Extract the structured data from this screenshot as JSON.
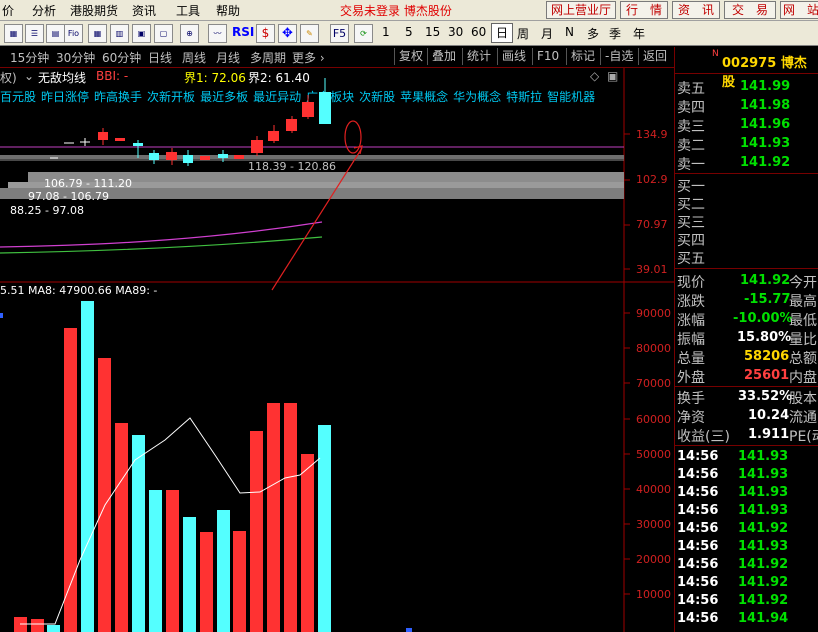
{
  "menubar": {
    "items": [
      "价",
      "分析",
      "港股期货",
      "资讯",
      "工具",
      "帮助"
    ],
    "warning": "交易未登录  博杰股份",
    "right_buttons": [
      "网上营业厅",
      "行　情",
      "资　讯",
      "交　易",
      "网　站"
    ]
  },
  "toolbar": {
    "rsi": "RSI",
    "f5": "F5",
    "periods": [
      "1",
      "5",
      "15",
      "30",
      "60"
    ],
    "views": [
      "日",
      "周",
      "月",
      "N",
      "多",
      "季",
      "年"
    ]
  },
  "periodbar": {
    "periods": [
      "15分钟",
      "30分钟",
      "60分钟",
      "日线",
      "周线",
      "月线",
      "多周期",
      "更多 ›"
    ],
    "buttons": [
      "复权",
      "叠加",
      "统计",
      "画线",
      "F10",
      "标记",
      "-自选",
      "返回"
    ]
  },
  "indicator_line": {
    "left": "权)",
    "name": "无敌均线",
    "bbi": "BBI: -",
    "jie1": "界1: 72.06",
    "jie2": "界2: 61.40"
  },
  "concepts": [
    "百元股",
    "昨日涨停",
    "昨高换手",
    "次新开板",
    "最近多板",
    "最近异动",
    "广东板块",
    "次新股",
    "苹果概念",
    "华为概念",
    "特斯拉",
    "智能机器"
  ],
  "price_chart": {
    "bands": [
      "106.79 - 111.20",
      "97.08 - 106.79",
      "88.25 - 97.08",
      "118.39 - 120.86"
    ],
    "y_labels": [
      "134.9",
      "102.9",
      "70.97",
      "39.01"
    ]
  },
  "volume_chart": {
    "ma_line": "5.51  MA8: 47900.66  MA89: -",
    "y_labels": [
      "90000",
      "80000",
      "70000",
      "60000",
      "50000",
      "40000",
      "30000",
      "20000",
      "10000"
    ]
  },
  "colors": {
    "up": "#ff3232",
    "down": "#54ffff",
    "accent": "#ffd700",
    "ask_bid_value": "#00e000"
  },
  "quote": {
    "code": "002975",
    "name": "博杰股",
    "asks": [
      [
        "卖五",
        "141.99"
      ],
      [
        "卖四",
        "141.98"
      ],
      [
        "卖三",
        "141.96"
      ],
      [
        "卖二",
        "141.93"
      ],
      [
        "卖一",
        "141.92"
      ]
    ],
    "bids": [
      [
        "买一",
        ""
      ],
      [
        "买二",
        ""
      ],
      [
        "买三",
        ""
      ],
      [
        "买四",
        ""
      ],
      [
        "买五",
        ""
      ]
    ],
    "stats": [
      [
        "现价",
        "141.92",
        "今开"
      ],
      [
        "涨跌",
        "-15.77",
        "最高"
      ],
      [
        "涨幅",
        "-10.00%",
        "最低"
      ],
      [
        "振幅",
        "15.80%",
        "量比"
      ],
      [
        "总量",
        "58206",
        "总额"
      ],
      [
        "外盘",
        "25601",
        "内盘"
      ],
      [
        "换手",
        "33.52%",
        "股本"
      ],
      [
        "净资",
        "10.24",
        "流通"
      ],
      [
        "收益(三)",
        "1.911",
        "PE(动"
      ]
    ],
    "ticks": [
      [
        "14:56",
        "141.93"
      ],
      [
        "14:56",
        "141.93"
      ],
      [
        "14:56",
        "141.93"
      ],
      [
        "14:56",
        "141.93"
      ],
      [
        "14:56",
        "141.92"
      ],
      [
        "14:56",
        "141.93"
      ],
      [
        "14:56",
        "141.92"
      ],
      [
        "14:56",
        "141.92"
      ],
      [
        "14:56",
        "141.92"
      ],
      [
        "14:56",
        "141.94"
      ]
    ]
  }
}
